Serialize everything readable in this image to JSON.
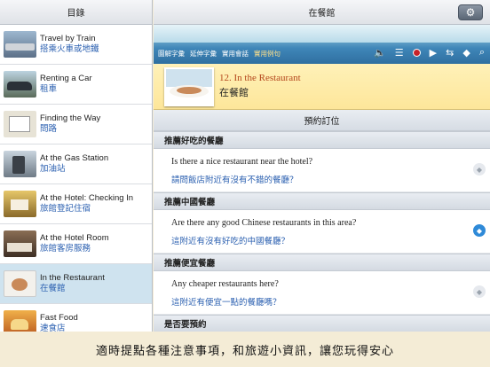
{
  "sidebar": {
    "title": "目錄",
    "items": [
      {
        "en": "Travel by Train",
        "zh": "搭乘火車或地鐵",
        "thumb": "train"
      },
      {
        "en": "Renting a Car",
        "zh": "租車",
        "thumb": "car"
      },
      {
        "en": "Finding the Way",
        "zh": "問路",
        "thumb": "map"
      },
      {
        "en": "At the Gas Station",
        "zh": "加油站",
        "thumb": "gas"
      },
      {
        "en": "At the Hotel: Checking In",
        "zh": "旅館登記住宿",
        "thumb": "hotel"
      },
      {
        "en": "At the Hotel Room",
        "zh": "旅館客房服務",
        "thumb": "room"
      },
      {
        "en": "In the Restaurant",
        "zh": "在餐館",
        "thumb": "restaurant"
      },
      {
        "en": "Fast Food",
        "zh": "速食店",
        "thumb": "food"
      }
    ]
  },
  "main": {
    "title": "在餐館",
    "settings_icon": "gear-icon"
  },
  "toolbar": {
    "links": [
      "圖解字彙",
      "延伸字彙",
      "實用會話",
      "實用例句"
    ],
    "active_link": "實用例句",
    "icons": [
      "speaker-icon",
      "playlist-icon",
      "record-icon",
      "play-icon",
      "repeat-icon",
      "tag-icon",
      "search-icon"
    ]
  },
  "lesson": {
    "title_en": "12. In the Restaurant",
    "title_zh": "在餐館"
  },
  "content": {
    "section": "預約訂位",
    "groups": [
      {
        "category": "推薦好吃的餐廳",
        "entries": [
          {
            "en": "Is there a nice restaurant near the hotel?",
            "zh": "請問飯店附近有沒有不錯的餐廳？",
            "tagged": false
          }
        ]
      },
      {
        "category": "推薦中國餐廳",
        "entries": [
          {
            "en": "Are there any good Chinese restaurants in this area?",
            "zh": "這附近有沒有好吃的中國餐廳？",
            "tagged": true
          }
        ]
      },
      {
        "category": "推薦便宜餐廳",
        "entries": [
          {
            "en": "Any cheaper restaurants here?",
            "zh": "這附近有便宜一點的餐廳嗎？",
            "tagged": false
          }
        ]
      },
      {
        "category": "是否要預約",
        "entries": []
      }
    ]
  },
  "caption": "適時提點各種注意事項，和旅遊小資訊，讓您玩得安心",
  "colors": {
    "accent_blue": "#2f6fa0",
    "link_blue": "#2a5fb0",
    "banner_yellow": "#fde69a",
    "active_row": "#cfe3ef",
    "title_orange": "#b4461c"
  }
}
